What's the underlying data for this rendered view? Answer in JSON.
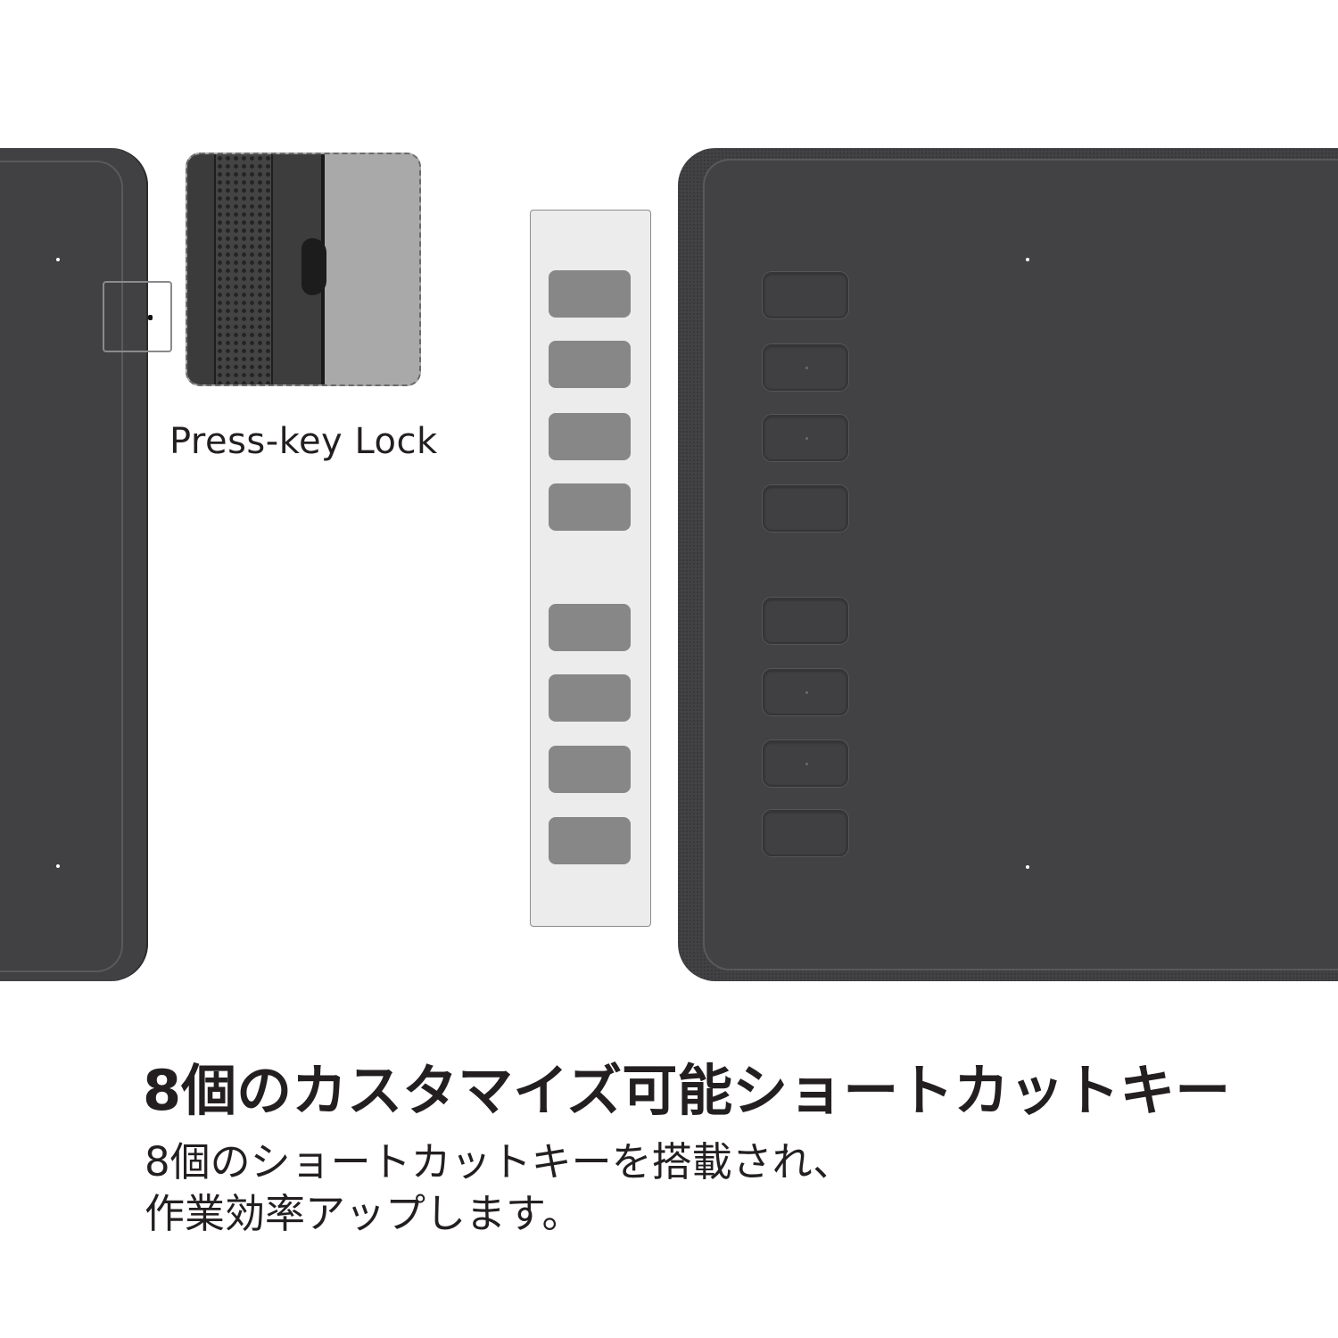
{
  "labels": {
    "lock": "Press-key Lock"
  },
  "headline": "8個のカスタマイズ可能ショートカットキー",
  "description": {
    "line1": "8個のショートカットキーを搭載され、",
    "line2": "作業効率アップします。"
  },
  "colors": {
    "tablet": "#414042",
    "panel_key": "#878787",
    "text": "#231f20"
  },
  "icons": [
    "press-key-lock-icon"
  ]
}
